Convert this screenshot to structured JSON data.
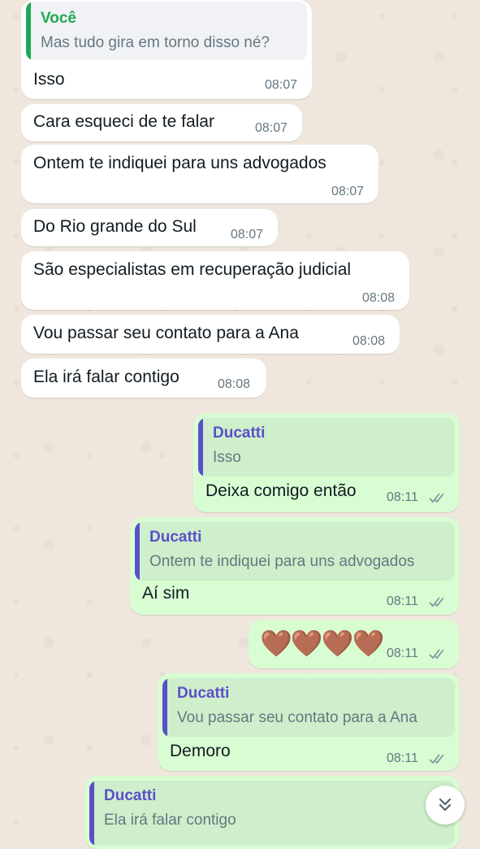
{
  "colors": {
    "incoming_bg": "#ffffff",
    "outgoing_bg": "#d9fdd3",
    "quote_green": "#1fa855",
    "quote_purple": "#5b4fc9",
    "tick_gray": "#8696a0"
  },
  "messages": [
    {
      "quote_author": "Você",
      "quote_text": "Mas tudo gira em torno disso né?",
      "text": "Isso",
      "time": "08:07"
    },
    {
      "text": "Cara esqueci de te falar",
      "time": "08:07"
    },
    {
      "text": "Ontem te indiquei para uns advogados",
      "time": "08:07"
    },
    {
      "text": "Do Rio grande do Sul",
      "time": "08:07"
    },
    {
      "text": "São especialistas em recuperação judicial",
      "time": "08:08"
    },
    {
      "text": "Vou passar seu contato para a Ana",
      "time": "08:08"
    },
    {
      "text": "Ela irá falar contigo",
      "time": "08:08"
    },
    {
      "quote_author": "Ducatti",
      "quote_text": "Isso",
      "text": "Deixa comigo então",
      "time": "08:11",
      "status": "double-tick-read"
    },
    {
      "quote_author": "Ducatti",
      "quote_text": "Ontem te indiquei para uns advogados",
      "text": "Aí sim",
      "time": "08:11",
      "status": "double-tick-read"
    },
    {
      "text": "🤎🤎🤎🤎",
      "time": "08:11",
      "status": "double-tick-read"
    },
    {
      "quote_author": "Ducatti",
      "quote_text": "Vou passar seu contato para a Ana",
      "text": "Demoro",
      "time": "08:11",
      "status": "double-tick-read"
    },
    {
      "quote_author": "Ducatti",
      "quote_text": "Ela irá falar contigo"
    }
  ],
  "scroll_button": {
    "icon": "double-chevron-down-icon"
  }
}
